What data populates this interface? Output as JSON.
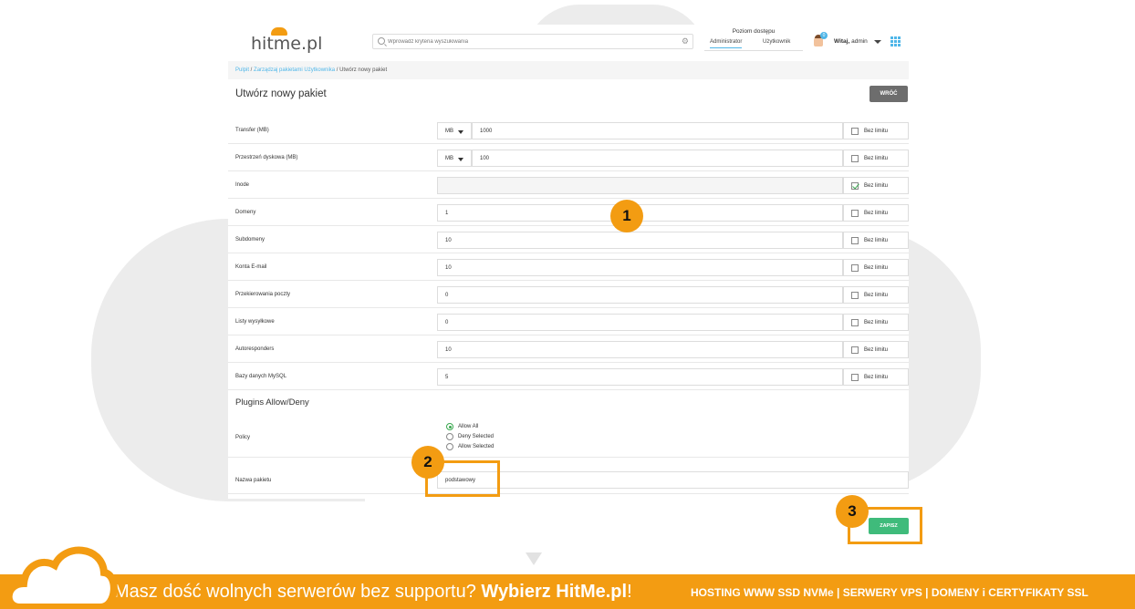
{
  "header": {
    "logo": "hitme.pl",
    "search_placeholder": "Wprowadź kryteria wyszukiwania",
    "access_label": "Poziom dostępu",
    "access_tabs": [
      "Administrator",
      "Użytkownik"
    ],
    "user_badge": "0",
    "user_greeting_prefix": "Witaj,",
    "user_name": "admin"
  },
  "breadcrumb": {
    "home": "Pulpit",
    "parent": "Zarządzaj pakietami Użytkownika",
    "current": "Utwórz nowy pakiet"
  },
  "page": {
    "title": "Utwórz nowy pakiet",
    "back_label": "WRÓĆ",
    "save_label": "ZAPISZ"
  },
  "form": {
    "no_limit_label": "Bez limitu",
    "rows": [
      {
        "label": "Transfer (MB)",
        "unit": "MB",
        "value": "1000",
        "no_limit": false
      },
      {
        "label": "Przestrzeń dyskowa (MB)",
        "unit": "MB",
        "value": "100",
        "no_limit": false
      },
      {
        "label": "Inode",
        "value": "",
        "no_limit": true
      },
      {
        "label": "Domeny",
        "value": "1",
        "no_limit": false
      },
      {
        "label": "Subdomeny",
        "value": "10",
        "no_limit": false
      },
      {
        "label": "Konta E-mail",
        "value": "10",
        "no_limit": false
      },
      {
        "label": "Przekierowania poczty",
        "value": "0",
        "no_limit": false
      },
      {
        "label": "Listy wysyłkowe",
        "value": "0",
        "no_limit": false
      },
      {
        "label": "Autoresponders",
        "value": "10",
        "no_limit": false
      },
      {
        "label": "Bazy danych MySQL",
        "value": "5",
        "no_limit": false
      }
    ],
    "plugins_title": "Plugins Allow/Deny",
    "policy_label": "Policy",
    "policy_options": [
      "Allow All",
      "Deny Selected",
      "Allow Selected"
    ],
    "policy_selected": "Allow All",
    "package_name_label": "Nazwa pakietu",
    "package_name_value": "podstawowy"
  },
  "callouts": [
    "1",
    "2",
    "3"
  ],
  "footer": {
    "slogan_prefix": "Masz dość wolnych serwerów bez supportu?",
    "slogan_brand": "Wybierz HitMe.pl",
    "slogan_suffix": "!",
    "services": "HOSTING WWW SSD NVMe | SERWERY VPS | DOMENY i CERTYFIKATY SSL"
  },
  "colors": {
    "accent": "#f39c12",
    "link": "#4fb6e8",
    "save": "#3fbb7b",
    "back": "#6d6d6d"
  }
}
